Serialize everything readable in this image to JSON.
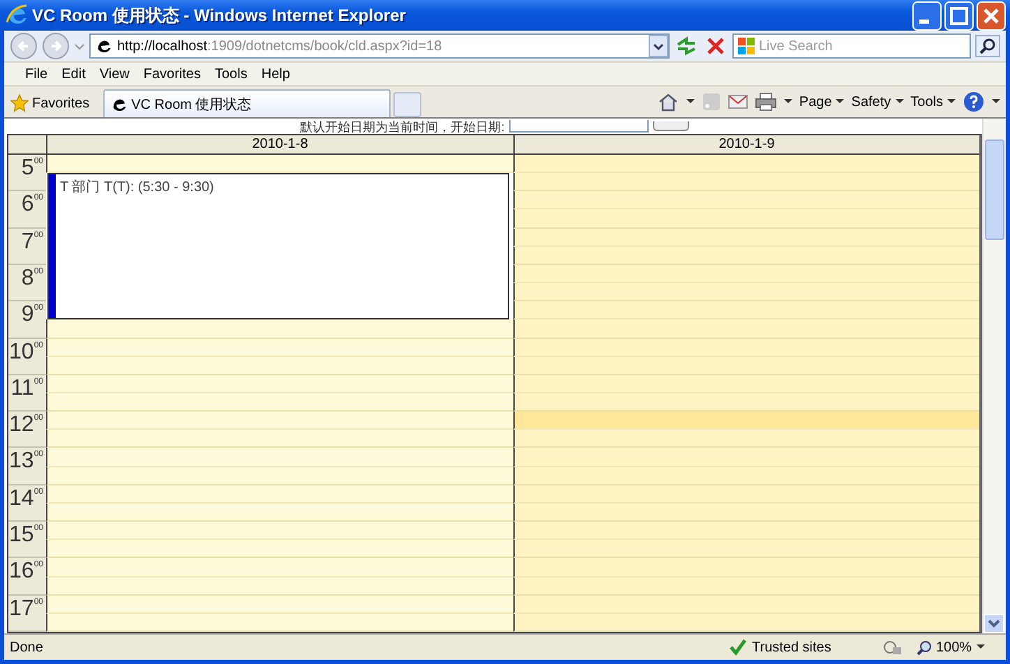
{
  "window": {
    "title": "VC Room 使用状态 - Windows Internet Explorer"
  },
  "address_bar": {
    "url_host": "http://localhost",
    "url_rest": ":1909/dotnetcms/book/cld.aspx?id=18",
    "search_placeholder": "Live Search"
  },
  "menu": [
    "File",
    "Edit",
    "View",
    "Favorites",
    "Tools",
    "Help"
  ],
  "favorites_button": "Favorites",
  "tabs": [
    {
      "label": "VC Room 使用状态",
      "selected": true
    }
  ],
  "command_bar": [
    "Page",
    "Safety",
    "Tools"
  ],
  "notice": "默认开始日期为当前时间，开始日期:",
  "calendar": {
    "hours": [
      {
        "hour": "5",
        "minutes": "00"
      },
      {
        "hour": "6",
        "minutes": "00"
      },
      {
        "hour": "7",
        "minutes": "00"
      },
      {
        "hour": "8",
        "minutes": "00"
      },
      {
        "hour": "9",
        "minutes": "00"
      },
      {
        "hour": "10",
        "minutes": "00"
      },
      {
        "hour": "11",
        "minutes": "00"
      },
      {
        "hour": "12",
        "minutes": "00"
      },
      {
        "hour": "13",
        "minutes": "00"
      },
      {
        "hour": "14",
        "minutes": "00"
      },
      {
        "hour": "15",
        "minutes": "00"
      },
      {
        "hour": "16",
        "minutes": "00"
      },
      {
        "hour": "17",
        "minutes": "00"
      }
    ],
    "days": [
      {
        "date": "2010-1-8",
        "selected": false,
        "events": [
          {
            "title": "T 部门 T(T): (5:30 - 9:30)"
          }
        ],
        "slots": [
          {
            "booked": false,
            "highlighted": false
          },
          {
            "booked": true
          },
          {
            "booked": true
          },
          {
            "booked": true
          },
          {
            "booked": true
          },
          {
            "booked": true
          },
          {
            "booked": true
          },
          {
            "booked": true
          },
          {
            "booked": true
          },
          {
            "booked": false,
            "highlighted": false
          },
          {
            "booked": false,
            "highlighted": false
          },
          {
            "booked": false,
            "highlighted": false
          },
          {
            "booked": false,
            "highlighted": false
          },
          {
            "booked": false,
            "highlighted": false
          },
          {
            "booked": false,
            "highlighted": false
          },
          {
            "booked": false,
            "highlighted": false
          },
          {
            "booked": false,
            "highlighted": false
          },
          {
            "booked": false,
            "highlighted": false
          },
          {
            "booked": false,
            "highlighted": false
          },
          {
            "booked": false,
            "highlighted": false
          },
          {
            "booked": false,
            "highlighted": false
          },
          {
            "booked": false,
            "highlighted": false
          },
          {
            "booked": false,
            "highlighted": false
          },
          {
            "booked": false,
            "highlighted": false
          },
          {
            "booked": false,
            "highlighted": false
          },
          {
            "booked": false,
            "highlighted": false
          }
        ]
      },
      {
        "date": "2010-1-9",
        "selected": true,
        "slots": [
          {
            "booked": false,
            "highlighted": false
          },
          {
            "booked": false,
            "highlighted": false
          },
          {
            "booked": false,
            "highlighted": false
          },
          {
            "booked": false,
            "highlighted": false
          },
          {
            "booked": false,
            "highlighted": false
          },
          {
            "booked": false,
            "highlighted": false
          },
          {
            "booked": false,
            "highlighted": false
          },
          {
            "booked": false,
            "highlighted": false
          },
          {
            "booked": false,
            "highlighted": false
          },
          {
            "booked": false,
            "highlighted": false
          },
          {
            "booked": false,
            "highlighted": false
          },
          {
            "booked": false,
            "highlighted": false
          },
          {
            "booked": false,
            "highlighted": false
          },
          {
            "booked": false,
            "highlighted": false
          },
          {
            "booked": false,
            "highlighted": true
          },
          {
            "booked": false,
            "highlighted": false
          },
          {
            "booked": false,
            "highlighted": false
          },
          {
            "booked": false,
            "highlighted": false
          },
          {
            "booked": false,
            "highlighted": false
          },
          {
            "booked": false,
            "highlighted": false
          },
          {
            "booked": false,
            "highlighted": false
          },
          {
            "booked": false,
            "highlighted": false
          },
          {
            "booked": false,
            "highlighted": false
          },
          {
            "booked": false,
            "highlighted": false
          },
          {
            "booked": false,
            "highlighted": false
          },
          {
            "booked": false,
            "highlighted": false
          }
        ]
      }
    ]
  },
  "status_bar": {
    "text": "Done",
    "zone": "Trusted sites",
    "zoom": "100%"
  }
}
